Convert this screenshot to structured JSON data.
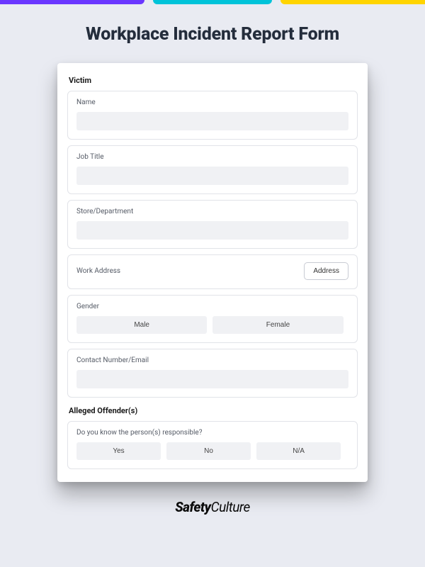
{
  "title": "Workplace Incident Report Form",
  "sections": {
    "victim": {
      "heading": "Victim",
      "fields": {
        "name_label": "Name",
        "job_title_label": "Job Title",
        "store_dept_label": "Store/Department",
        "work_address_label": "Work Address",
        "address_button": "Address",
        "gender_label": "Gender",
        "gender_options": {
          "male": "Male",
          "female": "Female"
        },
        "contact_label": "Contact Number/Email"
      }
    },
    "offenders": {
      "heading": "Alleged Offender(s)",
      "question": "Do you know the person(s) responsible?",
      "options": {
        "yes": "Yes",
        "no": "No",
        "na": "N/A"
      }
    }
  },
  "brand": {
    "part1": "Safety",
    "part2": "Culture"
  }
}
